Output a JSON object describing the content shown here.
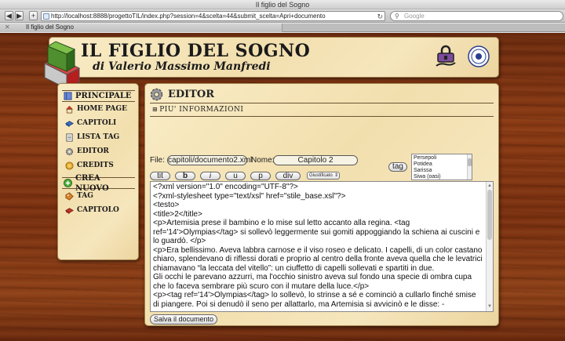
{
  "window": {
    "title": "Il figlio del Sogno"
  },
  "browser": {
    "url": "http://localhost:8888/progettoTIL/index.php?session=4&scelta=44&submit_scelta=Apri+documento",
    "search_placeholder": "Google",
    "tab_title": "Il figlio del Sogno"
  },
  "header": {
    "title": "IL FIGLIO DEL SOGNO",
    "subtitle": "di Valerio Massimo Manfredi"
  },
  "sidebar": {
    "section1": "PRINCIPALE",
    "items": [
      {
        "label": "HOME PAGE",
        "icon": "house-icon"
      },
      {
        "label": "CAPITOLI",
        "icon": "book-icon"
      },
      {
        "label": "LISTA TAG",
        "icon": "document-icon"
      },
      {
        "label": "EDITOR",
        "icon": "gear-icon"
      },
      {
        "label": "CREDITS",
        "icon": "coin-icon"
      }
    ],
    "section2": "CREA NUOVO",
    "new_items": [
      {
        "label": "TAG",
        "icon": "tag-icon"
      },
      {
        "label": "CAPITOLO",
        "icon": "book-icon"
      }
    ]
  },
  "editor": {
    "title": "EDITOR",
    "more_info": "PIU' INFORMAZIONI",
    "file_label": "File:",
    "file_value": "capitoli/documento2.xml",
    "name_label": "Nome:",
    "name_value": "Capitolo 2",
    "tag_button": "tag",
    "format_buttons": [
      "tit",
      "b",
      "i",
      "u",
      "p",
      "div"
    ],
    "align_select": "Giustificato",
    "tag_list": [
      "Persepoli",
      "Potidea",
      "Sarissa",
      "Siwa (oasi)"
    ],
    "content": [
      "<?xml version=\"1.0\" encoding=\"UTF-8\"?>",
      "<?xml-stylesheet type=\"text/xsl\" href=\"stile_base.xsl\"?>",
      "<testo>",
      "<title>2</title>",
      "<p>Artemisia prese il bambino e lo mise sul letto accanto alla regina. <tag ref='14'>Olympias</tag> si sollevò leggermente sui gomiti appoggiando la schiena ai cuscini e lo guardò. </p>",
      "<p>Era bellissimo. Aveva labbra carnose e il viso roseo e delicato. I capelli, di un color castano chiaro, splendevano di riflessi dorati e proprio al centro della fronte aveva quella che le levatrici chiamavano “la leccata del vitello”: un ciuffetto di capelli sollevati e spartiti in due.",
      "Gli occhi le parevano azzurri, ma l'occhio sinistro aveva sul fondo una specie di ombra cupa che lo faceva sembrare più scuro con il mutare della luce.</p>",
      "<p><tag ref='14'>Olympias</tag> lo sollevò, lo strinse a sé e cominciò a cullarlo finché smise di piangere. Poi si denudò il seno per allattarlo, ma Artemisia si avvicinò e le disse: -"
    ],
    "save_button": "Salva il documento"
  }
}
